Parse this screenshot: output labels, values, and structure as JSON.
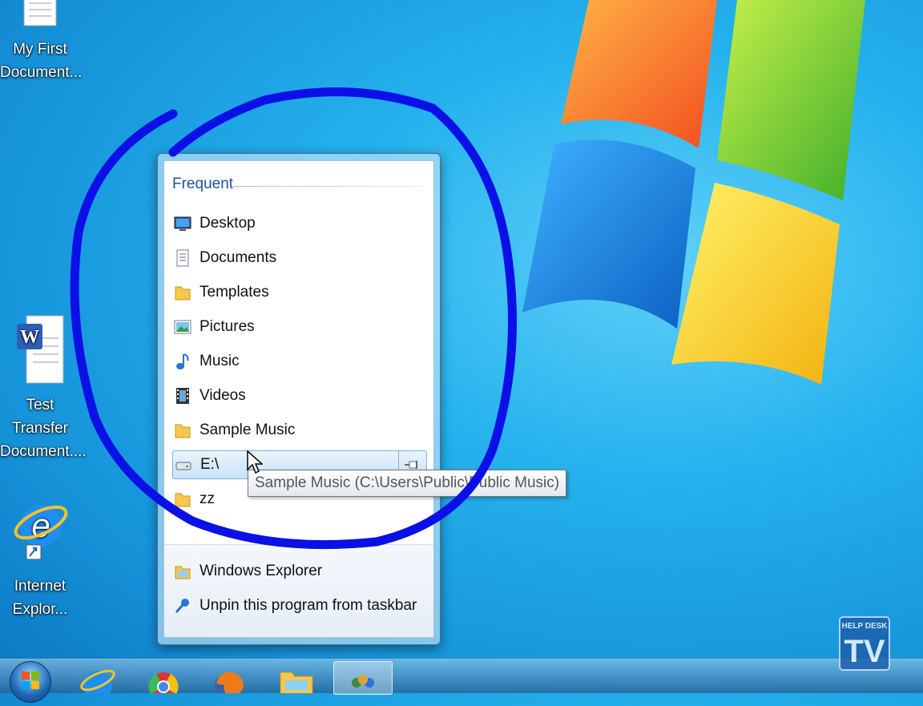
{
  "desktop": {
    "icons": [
      {
        "label_line1": "My First",
        "label_line2": "Document..."
      },
      {
        "label_line1": "Test Transfer",
        "label_line2": "Document...."
      },
      {
        "label_line1": "Internet",
        "label_line2": "Explor..."
      }
    ]
  },
  "jumplist": {
    "header": "Frequent",
    "items": [
      {
        "label": "Desktop",
        "icon": "desktop-icon"
      },
      {
        "label": "Documents",
        "icon": "documents-icon"
      },
      {
        "label": "Templates",
        "icon": "folder-icon"
      },
      {
        "label": "Pictures",
        "icon": "pictures-icon"
      },
      {
        "label": "Music",
        "icon": "music-note-icon"
      },
      {
        "label": "Videos",
        "icon": "videos-icon"
      },
      {
        "label": "Sample Music",
        "icon": "folder-icon"
      },
      {
        "label": "E:\\",
        "icon": "drive-icon"
      },
      {
        "label": "zz",
        "icon": "folder-icon"
      }
    ],
    "tasks": [
      {
        "label": "Windows Explorer",
        "icon": "windows-explorer-icon"
      },
      {
        "label": "Unpin this program from taskbar",
        "icon": "unpin-icon"
      }
    ]
  },
  "tooltip": {
    "text": "Sample Music (C:\\Users\\Public\\Public Music)"
  },
  "watermark": {
    "line1": "HELP DESK",
    "line2": "TV"
  },
  "colors": {
    "accent": "#1e4f9c",
    "annotation": "#0a10e6",
    "hover_border": "#7ab2e2"
  }
}
